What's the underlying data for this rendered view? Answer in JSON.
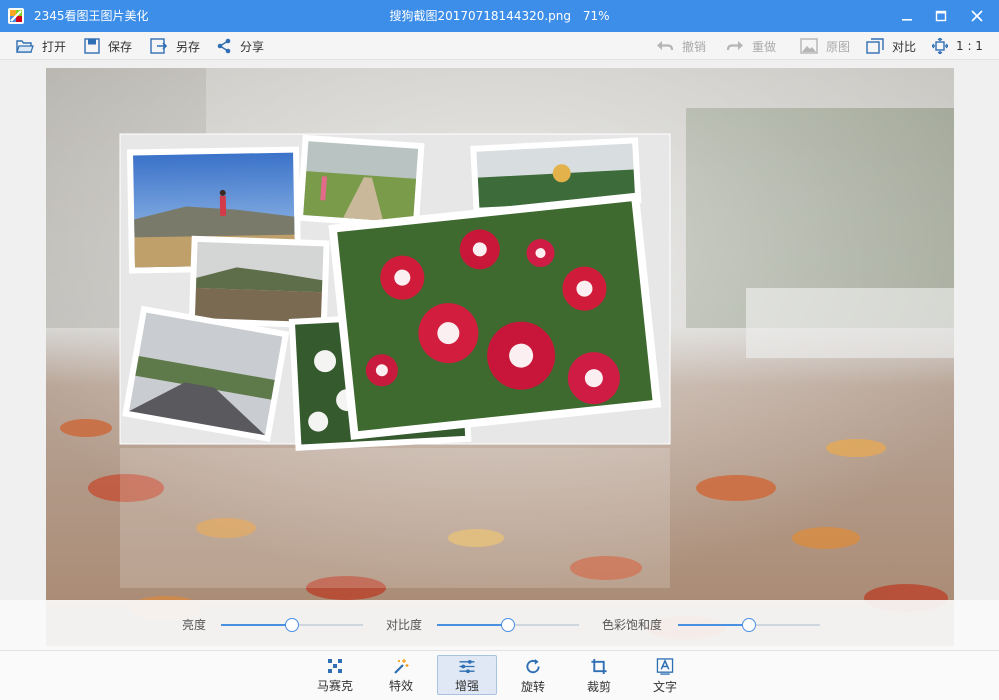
{
  "titlebar": {
    "app_title": "2345看图王图片美化",
    "file_name": "搜狗截图20170718144320.png",
    "zoom": "71%"
  },
  "toolbar": {
    "open_label": "打开",
    "save_label": "保存",
    "saveas_label": "另存",
    "share_label": "分享",
    "undo_label": "撤销",
    "redo_label": "重做",
    "original_label": "原图",
    "compare_label": "对比",
    "ratio_label": "1 : 1"
  },
  "adjust": {
    "brightness": {
      "label": "亮度",
      "value": 0.5
    },
    "contrast": {
      "label": "对比度",
      "value": 0.5
    },
    "saturation": {
      "label": "色彩饱和度",
      "value": 0.5
    }
  },
  "bottom_tools": [
    {
      "label": "马赛克",
      "icon": "mosaic-icon",
      "active": false
    },
    {
      "label": "特效",
      "icon": "magic-wand-icon",
      "active": false
    },
    {
      "label": "增强",
      "icon": "sliders-icon",
      "active": true
    },
    {
      "label": "旋转",
      "icon": "rotate-icon",
      "active": false
    },
    {
      "label": "裁剪",
      "icon": "crop-icon",
      "active": false
    },
    {
      "label": "文字",
      "icon": "text-icon",
      "active": false
    }
  ],
  "colors": {
    "titlebar": "#3d8ee8",
    "accent": "#4a90e2",
    "active_tool_bg": "#dfe8f4"
  }
}
